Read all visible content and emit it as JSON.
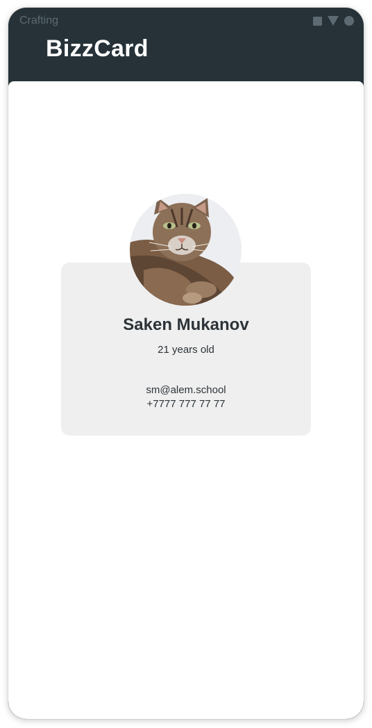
{
  "status_bar": {
    "title": "Crafting",
    "icons": [
      "square-icon",
      "triangle-icon",
      "circle-icon"
    ]
  },
  "app_bar": {
    "title": "BizzCard"
  },
  "profile": {
    "avatar": "cat-photo",
    "name": "Saken Mukanov",
    "age": "21 years old",
    "email": "sm@alem.school",
    "phone": "+7777 777 77 77"
  },
  "colors": {
    "app_bar": "#263238",
    "card": "#efefef",
    "text": "#2c3338"
  }
}
